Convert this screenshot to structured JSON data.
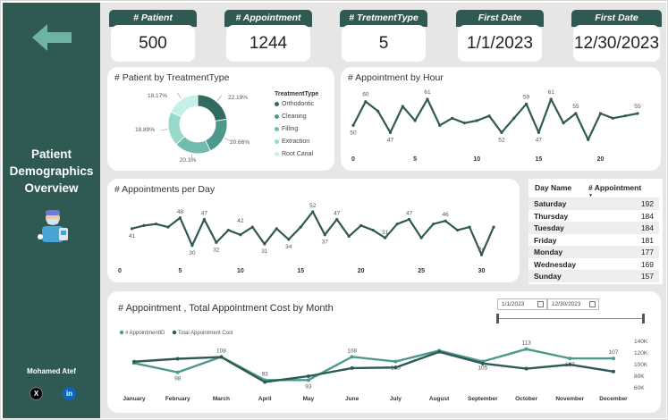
{
  "sidebar": {
    "title_lines": [
      "Patient",
      "Demographics",
      "Overview"
    ],
    "author": "Mohamed Atef",
    "social": {
      "x": "X",
      "linkedin": "in"
    }
  },
  "kpis": [
    {
      "label": "# Patient",
      "value": "500"
    },
    {
      "label": "# Appointment",
      "value": "1244"
    },
    {
      "label": "# TretmentType",
      "value": "5"
    },
    {
      "label": "First Date",
      "value": "1/1/2023"
    },
    {
      "label": "First Date",
      "value": "12/30/2023"
    }
  ],
  "donut": {
    "title": "# Patient by TreatmentType",
    "legend_title": "TreatmentType",
    "pct_labels": [
      "22.19%",
      "20.66%",
      "20.1%",
      "18.89%",
      "18.17%"
    ],
    "items": [
      {
        "name": "Orthodontic",
        "color": "#2f6b5f"
      },
      {
        "name": "Cleaning",
        "color": "#4d9a8c"
      },
      {
        "name": "Filling",
        "color": "#72bcae"
      },
      {
        "name": "Extraction",
        "color": "#98d9cc"
      },
      {
        "name": "Root Canal",
        "color": "#c4f0e8"
      }
    ]
  },
  "hour_chart": {
    "title": "# Appointment by Hour",
    "x_ticks": [
      "0",
      "5",
      "10",
      "15",
      "20"
    ],
    "point_labels": [
      "60",
      "61",
      "50",
      "47",
      "59",
      "61",
      "55",
      "55",
      "52",
      "47"
    ]
  },
  "day_chart": {
    "title": "# Appointments per Day",
    "x_ticks": [
      "0",
      "5",
      "10",
      "15",
      "20",
      "25",
      "30"
    ],
    "point_labels": [
      "48",
      "47",
      "42",
      "52",
      "47",
      "47",
      "46",
      "41",
      "30",
      "32",
      "31",
      "34",
      "37",
      "31",
      "24"
    ]
  },
  "weekday_table": {
    "headers": [
      "Day Name",
      "# Appointment"
    ],
    "rows": [
      {
        "day": "Saturday",
        "count": "192"
      },
      {
        "day": "Thursday",
        "count": "184"
      },
      {
        "day": "Tuesday",
        "count": "184"
      },
      {
        "day": "Friday",
        "count": "181"
      },
      {
        "day": "Monday",
        "count": "177"
      },
      {
        "day": "Wednesday",
        "count": "169"
      },
      {
        "day": "Sunday",
        "count": "157"
      }
    ]
  },
  "month_chart": {
    "title": "# Appointment , Total Appointment Cost by Month",
    "date_from": "1/1/2023",
    "date_to": "12/30/2023",
    "legend": [
      "# AppointmentID",
      "Total Appointment Cost"
    ],
    "months": [
      "January",
      "February",
      "March",
      "April",
      "May",
      "June",
      "July",
      "August",
      "September",
      "October",
      "November",
      "December"
    ],
    "y_right_ticks": [
      "140K",
      "120K",
      "100K",
      "80K",
      "60K"
    ],
    "point_labels": [
      "98",
      "108",
      "93",
      "93",
      "108",
      "105",
      "105",
      "113",
      "107",
      "107"
    ],
    "colors": {
      "appointments": "#4d9a8c",
      "cost": "#2f5a53"
    }
  },
  "chart_data": [
    {
      "type": "pie",
      "title": "# Patient by TreatmentType",
      "categories": [
        "Orthodontic",
        "Cleaning",
        "Filling",
        "Extraction",
        "Root Canal"
      ],
      "values": [
        22.19,
        20.66,
        20.1,
        18.89,
        18.17
      ]
    },
    {
      "type": "line",
      "title": "# Appointment by Hour",
      "x": [
        0,
        1,
        2,
        3,
        4,
        5,
        6,
        7,
        8,
        9,
        10,
        11,
        12,
        13,
        14,
        15,
        16,
        17,
        18,
        19,
        20,
        21,
        22,
        23
      ],
      "values": [
        50,
        60,
        56,
        47,
        58,
        52,
        61,
        50,
        53,
        51,
        52,
        54,
        47,
        53,
        59,
        47,
        61,
        51,
        55,
        44,
        55,
        53,
        54,
        55
      ]
    },
    {
      "type": "line",
      "title": "# Appointments per Day",
      "x": [
        1,
        2,
        3,
        4,
        5,
        6,
        7,
        8,
        9,
        10,
        11,
        12,
        13,
        14,
        15,
        16,
        17,
        18,
        19,
        20,
        21,
        22,
        23,
        24,
        25,
        26,
        27,
        28,
        29,
        30,
        31
      ],
      "values": [
        41,
        43,
        44,
        42,
        48,
        30,
        47,
        32,
        40,
        37,
        42,
        31,
        41,
        34,
        42,
        52,
        37,
        47,
        36,
        43,
        40,
        35,
        44,
        47,
        35,
        44,
        46,
        40,
        42,
        24,
        42
      ]
    },
    {
      "type": "line",
      "title": "# Appointment , Total Appointment Cost by Month",
      "categories": [
        "January",
        "February",
        "March",
        "April",
        "May",
        "June",
        "July",
        "August",
        "September",
        "October",
        "November",
        "December"
      ],
      "series": [
        {
          "name": "# AppointmentID",
          "values": [
            104,
            98,
            108,
            93,
            93,
            108,
            105,
            112,
            105,
            113,
            107,
            107
          ]
        },
        {
          "name": "Total Appointment Cost",
          "values": [
            105000,
            110000,
            113000,
            70000,
            80000,
            94000,
            95000,
            122000,
            102000,
            93000,
            100000,
            88000
          ]
        }
      ],
      "y2_ticks": [
        "140K",
        "120K",
        "100K",
        "80K",
        "60K"
      ]
    }
  ]
}
